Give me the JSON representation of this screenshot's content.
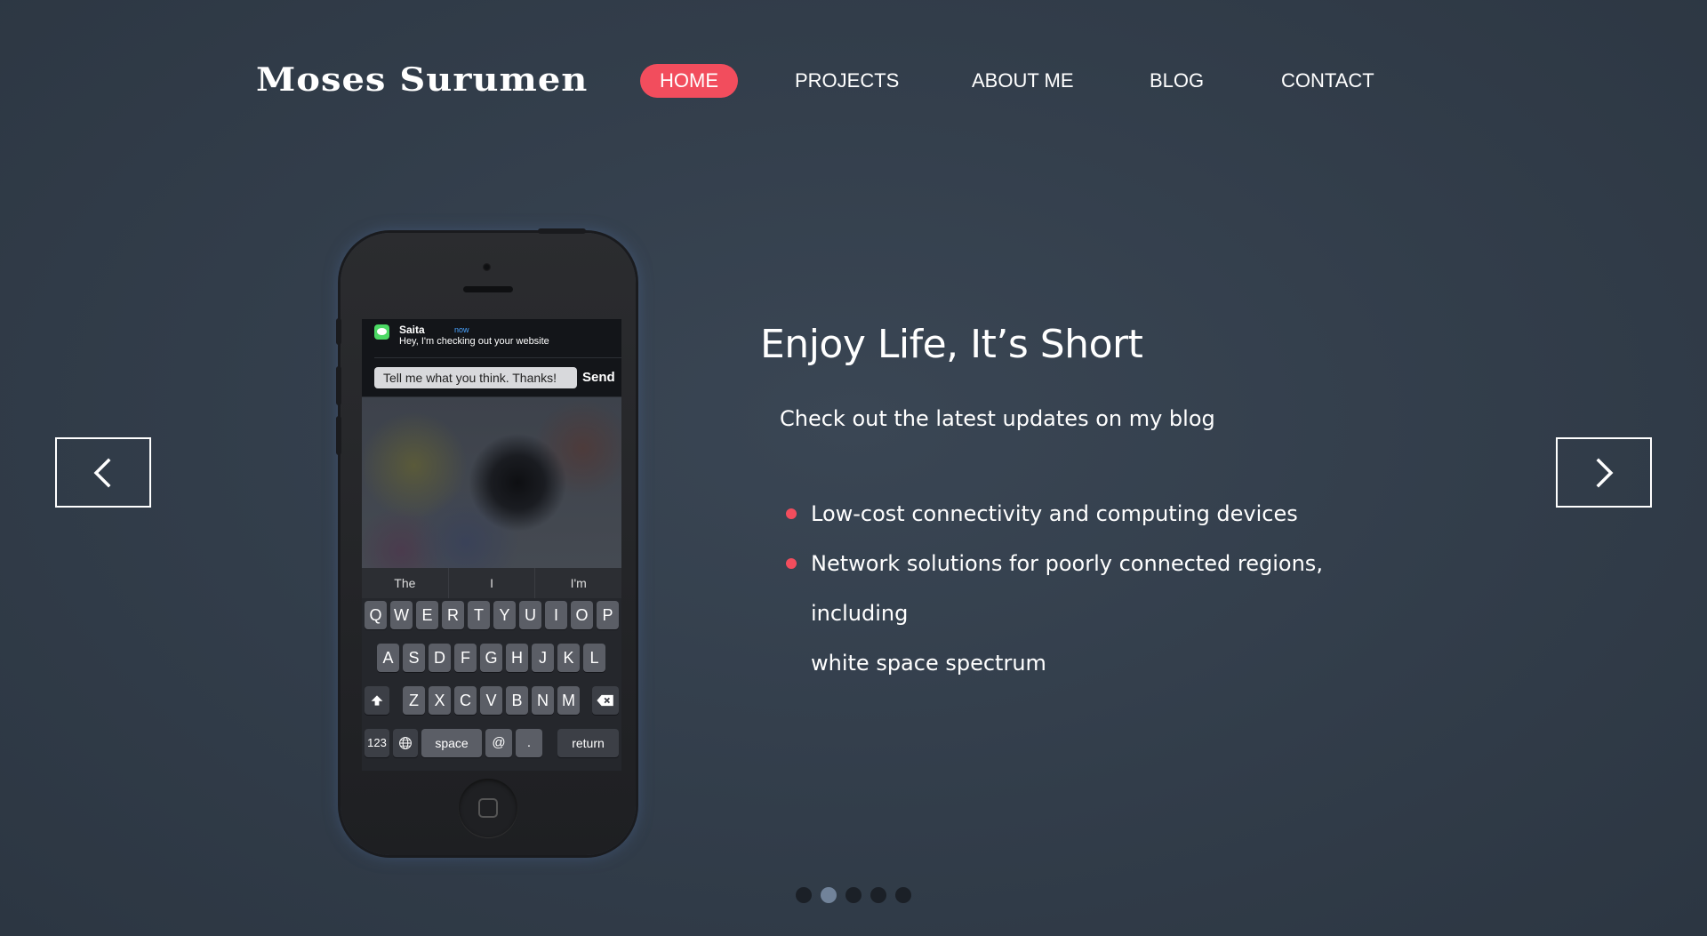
{
  "header": {
    "logo_text": "Moses Surumen",
    "nav": [
      {
        "label": "HOME",
        "active": true
      },
      {
        "label": "PROJECTS",
        "active": false
      },
      {
        "label": "ABOUT ME",
        "active": false
      },
      {
        "label": "BLOG",
        "active": false
      },
      {
        "label": "CONTACT",
        "active": false
      }
    ]
  },
  "slider": {
    "prev_icon": "chevron-left-icon",
    "next_icon": "chevron-right-icon",
    "slide_count": 5,
    "active_slide": 2
  },
  "phone": {
    "notification": {
      "sender": "Saita",
      "time": "now",
      "message": "Hey, I'm checking out your website",
      "reply_text": "Tell me what you think. Thanks!",
      "send_label": "Send"
    },
    "suggestions": [
      "The",
      "I",
      "I'm"
    ],
    "keyboard": {
      "row1": [
        "Q",
        "W",
        "E",
        "R",
        "T",
        "Y",
        "U",
        "I",
        "O",
        "P"
      ],
      "row2": [
        "A",
        "S",
        "D",
        "F",
        "G",
        "H",
        "J",
        "K",
        "L"
      ],
      "row3": [
        "Z",
        "X",
        "C",
        "V",
        "B",
        "N",
        "M"
      ],
      "numbers_label": "123",
      "space_label": "space",
      "at_label": "@",
      "period_label": ".",
      "return_label": "return"
    }
  },
  "content": {
    "headline": "Enjoy Life, It’s Short",
    "subline": "Check out the latest updates on my blog",
    "features": [
      "Low-cost connectivity and computing devices",
      "Network solutions for poorly connected regions, including",
      "white space spectrum"
    ]
  },
  "colors": {
    "accent": "#f24d5d",
    "background": "#343f4c",
    "dot_active": "#71839a",
    "dot_inactive": "#1b2027"
  }
}
